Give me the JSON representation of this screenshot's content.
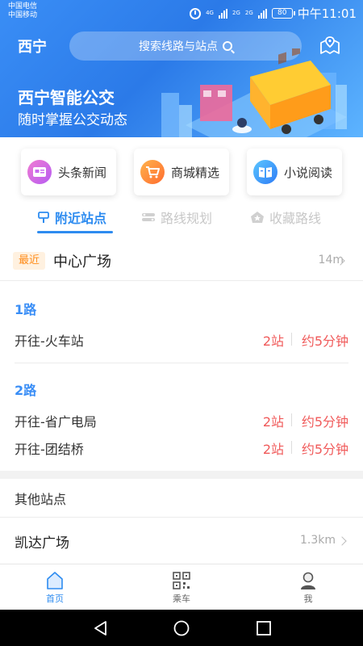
{
  "status_bar": {
    "carrier_1": "中国电信",
    "carrier_2": "中国移动",
    "network_1": "4G",
    "network_2": "2G",
    "network_3": "2G",
    "battery": "80",
    "time": "中午11:01"
  },
  "header": {
    "city": "西宁",
    "search_placeholder": "搜索线路与站点",
    "map_icon": "map-pin-icon"
  },
  "banner": {
    "title": "西宁智能公交",
    "subtitle": "随时掌握公交动态"
  },
  "quick_links": [
    {
      "label": "头条新闻",
      "icon": "news-icon"
    },
    {
      "label": "商城精选",
      "icon": "cart-icon"
    },
    {
      "label": "小说阅读",
      "icon": "book-icon"
    }
  ],
  "tabs": [
    {
      "label": "附近站点",
      "icon": "signpost-icon",
      "active": true
    },
    {
      "label": "路线规划",
      "icon": "route-icon",
      "active": false
    },
    {
      "label": "收藏路线",
      "icon": "favorite-icon",
      "active": false
    }
  ],
  "nearest_station": {
    "badge": "最近",
    "name": "中心广场",
    "distance": "14m"
  },
  "routes": [
    {
      "name": "1路",
      "directions": [
        {
          "to": "开往-火车站",
          "stops": "2站",
          "eta": "约5分钟"
        }
      ]
    },
    {
      "name": "2路",
      "directions": [
        {
          "to": "开往-省广电局",
          "stops": "2站",
          "eta": "约5分钟"
        },
        {
          "to": "开往-团结桥",
          "stops": "2站",
          "eta": "约5分钟"
        }
      ]
    }
  ],
  "other_stations": {
    "title": "其他站点",
    "items": [
      {
        "name": "凯达广场",
        "distance": "1.3km"
      }
    ]
  },
  "bottom_tabs": [
    {
      "label": "首页",
      "icon": "home-icon",
      "active": true
    },
    {
      "label": "乘车",
      "icon": "qr-code-icon",
      "active": false
    },
    {
      "label": "我",
      "icon": "profile-icon",
      "active": false
    }
  ],
  "colors": {
    "primary": "#2e8cf0",
    "hero_start": "#3a8ef6",
    "hero_end": "#5db4ff",
    "alert_red": "#f05a5a",
    "recent_badge": "#ff8c1a"
  }
}
